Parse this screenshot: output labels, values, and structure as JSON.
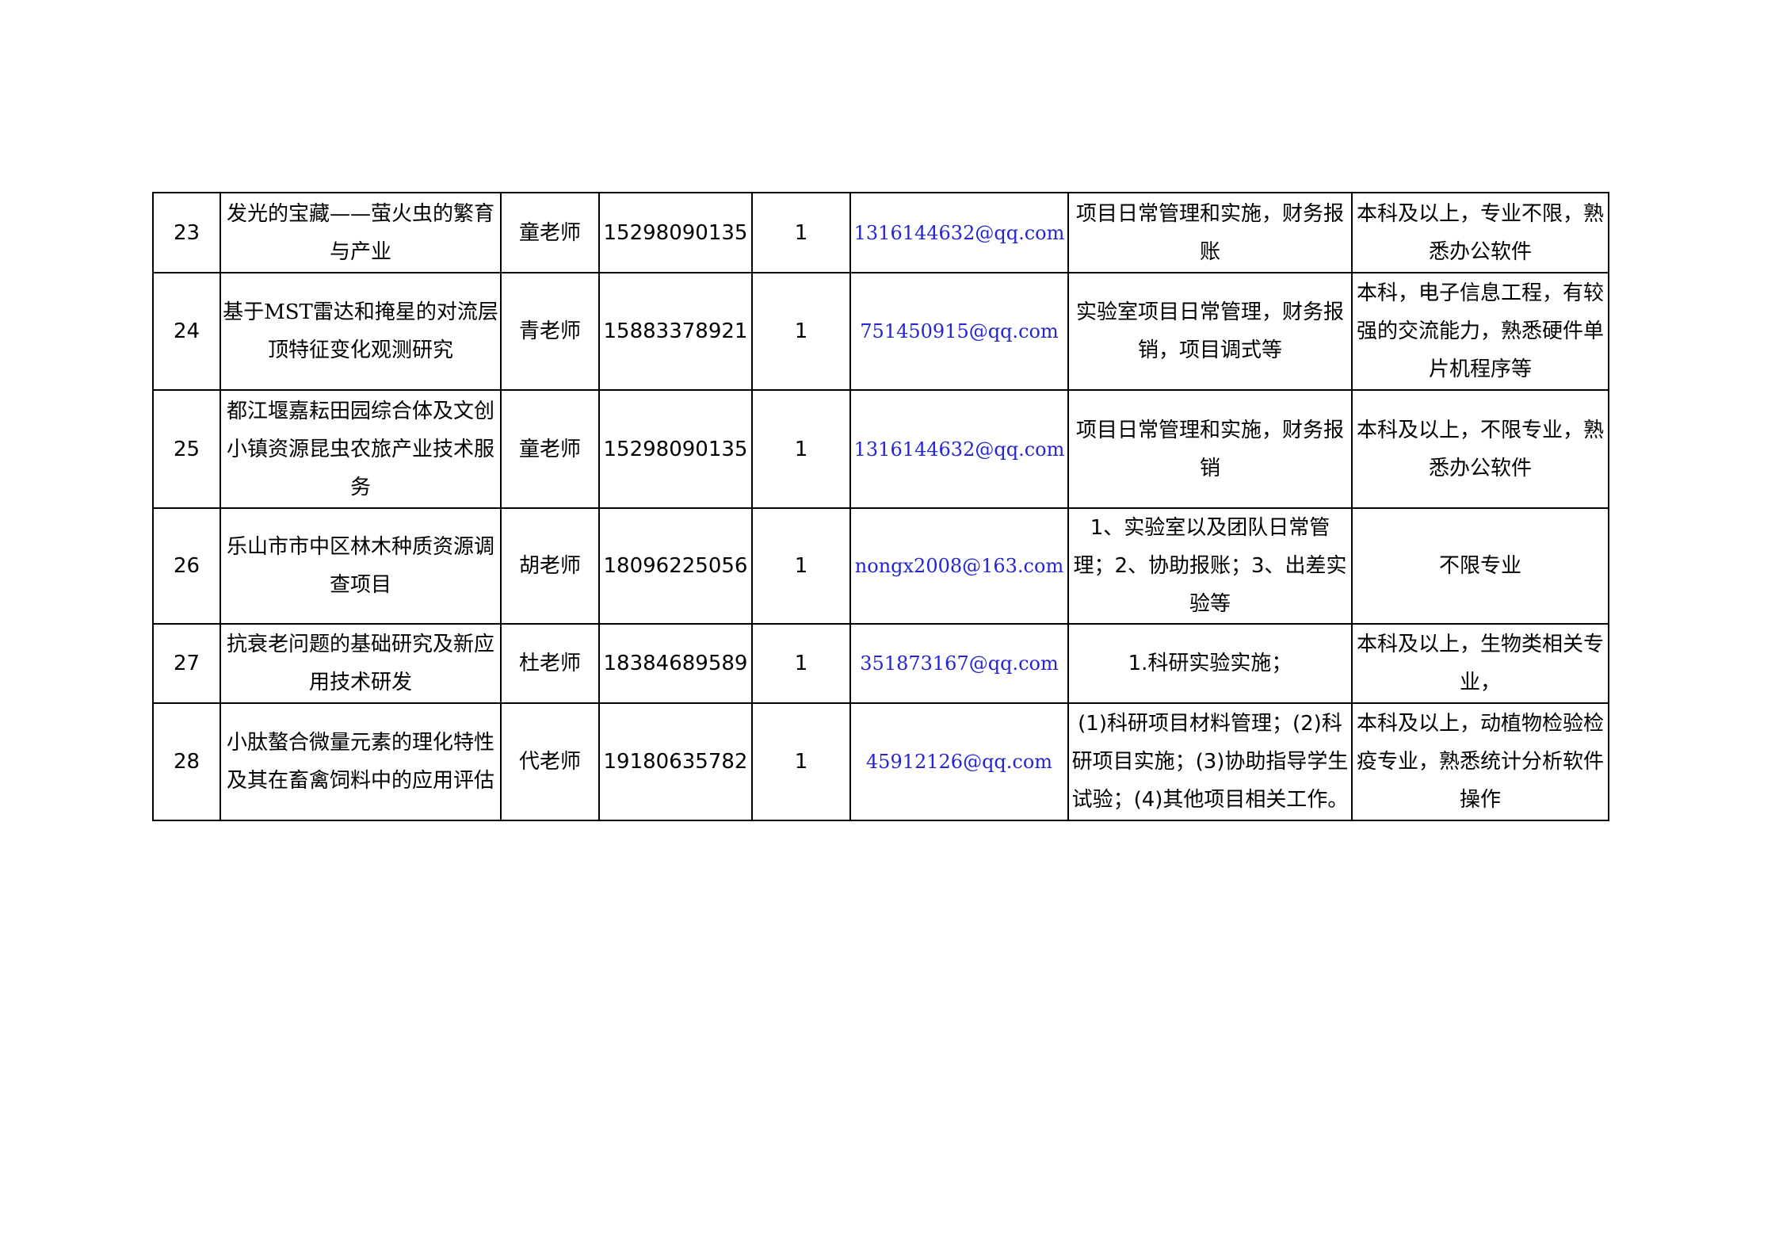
{
  "rows": [
    {
      "no": "23",
      "project": "发光的宝藏——萤火虫的繁育与产业",
      "teacher": "童老师",
      "phone": "15298090135",
      "count": "1",
      "email": "1316144632@qq.com",
      "duty": "项目日常管理和实施，财务报账",
      "requirement": "本科及以上，专业不限，熟悉办公软件"
    },
    {
      "no": "24",
      "project": "基于MST雷达和掩星的对流层顶特征变化观测研究",
      "teacher": "青老师",
      "phone": "15883378921",
      "count": "1",
      "email": "751450915@qq.com",
      "duty": "实验室项目日常管理，财务报销，项目调式等",
      "requirement": "本科，电子信息工程，有较强的交流能力，熟悉硬件单片机程序等"
    },
    {
      "no": "25",
      "project": "都江堰嘉耘田园综合体及文创小镇资源昆虫农旅产业技术服务",
      "teacher": "童老师",
      "phone": "15298090135",
      "count": "1",
      "email": "1316144632@qq.com",
      "duty": "项目日常管理和实施，财务报销",
      "requirement": "本科及以上，不限专业，熟悉办公软件"
    },
    {
      "no": "26",
      "project": "乐山市市中区林木种质资源调查项目",
      "teacher": "胡老师",
      "phone": "18096225056",
      "count": "1",
      "email": "nongx2008@163.com",
      "duty": "1、实验室以及团队日常管理；2、协助报账；3、出差实验等",
      "requirement": "不限专业"
    },
    {
      "no": "27",
      "project": "抗衰老问题的基础研究及新应用技术研发",
      "teacher": "杜老师",
      "phone": "18384689589",
      "count": "1",
      "email": "351873167@qq.com",
      "duty": "1.科研实验实施；",
      "requirement": "本科及以上，生物类相关专业，"
    },
    {
      "no": "28",
      "project": "小肽螯合微量元素的理化特性及其在畜禽饲料中的应用评估",
      "teacher": "代老师",
      "phone": "19180635782",
      "count": "1",
      "email": "45912126@qq.com",
      "duty": "(1)科研项目材料管理；(2)科研项目实施；(3)协助指导学生试验；(4)其他项目相关工作。",
      "requirement": "本科及以上，动植物检验检疫专业，熟悉统计分析软件操作"
    }
  ]
}
